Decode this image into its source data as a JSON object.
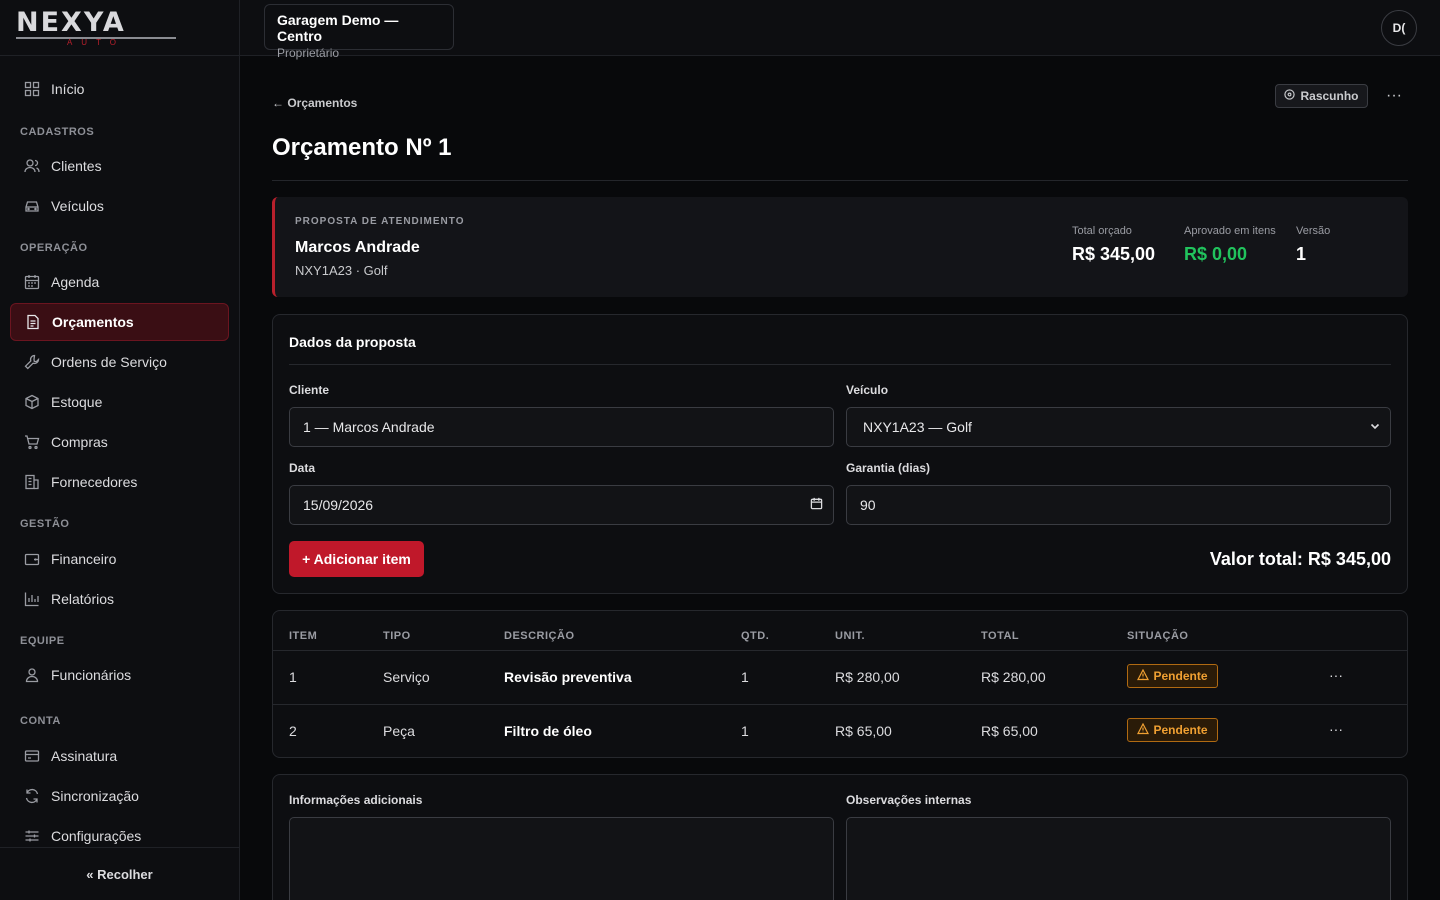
{
  "brand": {
    "logo_main": "NEXYA",
    "logo_sub": "AUTO"
  },
  "topbar": {
    "org_name": "Garagem Demo — Centro",
    "org_role": "Proprietário",
    "avatar_initials": "D("
  },
  "sidebar": {
    "home": "Início",
    "sections": {
      "cadastros": "CADASTROS",
      "operacao": "OPERAÇÃO",
      "gestao": "GESTÃO",
      "equipe": "EQUIPE",
      "conta": "CONTA"
    },
    "items": {
      "clientes": "Clientes",
      "veiculos": "Veículos",
      "agenda": "Agenda",
      "orcamentos": "Orçamentos",
      "ordens": "Ordens de Serviço",
      "estoque": "Estoque",
      "compras": "Compras",
      "fornecedores": "Fornecedores",
      "financeiro": "Financeiro",
      "relatorios": "Relatórios",
      "funcionarios": "Funcionários",
      "assinatura": "Assinatura",
      "sincronizacao": "Sincronização",
      "configuracoes": "Configurações"
    },
    "collapse_label": "« Recolher"
  },
  "page": {
    "back_label": "← Orçamentos",
    "status_label": "Rascunho",
    "title": "Orçamento Nº 1"
  },
  "summary": {
    "label": "PROPOSTA DE ATENDIMENTO",
    "client": "Marcos Andrade",
    "vehicle": "NXY1A23 · Golf",
    "total_label": "Total orçado",
    "total_value": "R$ 345,00",
    "approved_label": "Aprovado em itens",
    "approved_value": "R$ 0,00",
    "version_label": "Versão",
    "version_value": "1"
  },
  "form": {
    "title": "Dados da proposta",
    "client_label": "Cliente",
    "client_value": "1 — Marcos Andrade",
    "vehicle_label": "Veículo",
    "vehicle_value": "NXY1A23 — Golf",
    "date_label": "Data",
    "date_value": "15/09/2026",
    "warranty_label": "Garantia (dias)",
    "warranty_value": "90",
    "add_item_label": "+ Adicionar item",
    "total_label": "Valor total: R$ 345,00"
  },
  "table": {
    "headers": [
      "ITEM",
      "TIPO",
      "DESCRIÇÃO",
      "QTD.",
      "UNIT.",
      "TOTAL",
      "SITUAÇÃO"
    ],
    "rows": [
      {
        "item": "1",
        "tipo": "Serviço",
        "descricao": "Revisão preventiva",
        "qtd": "1",
        "unit": "R$ 280,00",
        "total": "R$ 280,00",
        "situacao": "Pendente"
      },
      {
        "item": "2",
        "tipo": "Peça",
        "descricao": "Filtro de óleo",
        "qtd": "1",
        "unit": "R$ 65,00",
        "total": "R$ 65,00",
        "situacao": "Pendente"
      }
    ]
  },
  "notes": {
    "additional_label": "Informações adicionais",
    "internal_label": "Observações internas"
  },
  "colors": {
    "accent": "#c0182a",
    "green": "#21c45d",
    "warning": "#f0a032"
  }
}
